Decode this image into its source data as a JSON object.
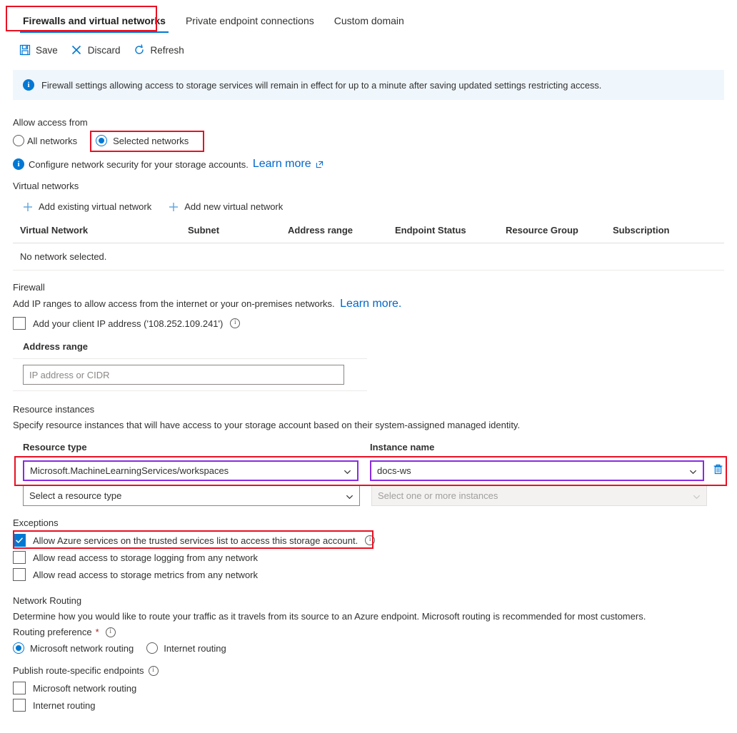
{
  "tabs": [
    {
      "label": "Firewalls and virtual networks",
      "active": true,
      "highlighted": true
    },
    {
      "label": "Private endpoint connections",
      "active": false,
      "highlighted": false
    },
    {
      "label": "Custom domain",
      "active": false,
      "highlighted": false
    }
  ],
  "toolbar": {
    "save_label": "Save",
    "discard_label": "Discard",
    "refresh_label": "Refresh",
    "save_icon": "save-floppy-icon",
    "discard_icon": "close-x-icon",
    "refresh_icon": "refresh-circular-arrow-icon"
  },
  "banner": {
    "icon": "info-filled-icon",
    "text": "Firewall settings allowing access to storage services will remain in effect for up to a minute after saving updated settings restricting access.",
    "background": "#eff6fc"
  },
  "allow_access": {
    "section_label": "Allow access from",
    "options": [
      {
        "label": "All networks",
        "selected": false
      },
      {
        "label": "Selected networks",
        "selected": true
      }
    ],
    "hint_icon": "info-filled-icon",
    "hint_text": "Configure network security for your storage accounts.",
    "hint_link": "Learn more",
    "hint_link_icon": "external-link-icon"
  },
  "virtual_networks": {
    "section_label": "Virtual networks",
    "actions": [
      {
        "label": "Add existing virtual network",
        "icon": "plus-icon"
      },
      {
        "label": "Add new virtual network",
        "icon": "plus-icon"
      }
    ],
    "columns": [
      "Virtual Network",
      "Subnet",
      "Address range",
      "Endpoint Status",
      "Resource Group",
      "Subscription"
    ],
    "empty_text": "No network selected."
  },
  "firewall": {
    "section_label": "Firewall",
    "description": "Add IP ranges to allow access from the internet or your on-premises networks.",
    "description_link": "Learn more.",
    "client_ip_checkbox": {
      "label": "Add your client IP address ('108.252.109.241')",
      "checked": false,
      "info_icon": "info-outline-icon"
    },
    "address_range_label": "Address range",
    "address_range_placeholder": "IP address or CIDR",
    "address_range_value": ""
  },
  "resource_instances": {
    "section_label": "Resource instances",
    "description": "Specify resource instances that will have access to your storage account based on their system-assigned managed identity.",
    "columns": {
      "resource_type": "Resource type",
      "instance_name": "Instance name"
    },
    "rows": [
      {
        "resource_type_value": "Microsoft.MachineLearningServices/workspaces",
        "instance_name_value": "docs-ws",
        "focused": true,
        "highlighted": true,
        "disabled": false,
        "delete_icon": "trash-icon"
      },
      {
        "resource_type_value": "Select a resource type",
        "instance_name_value": "Select one or more instances",
        "focused": false,
        "highlighted": false,
        "disabled": true,
        "delete_icon": ""
      }
    ]
  },
  "exceptions": {
    "section_label": "Exceptions",
    "items": [
      {
        "label": "Allow Azure services on the trusted services list to access this storage account.",
        "checked": true,
        "info_icon": "info-outline-icon",
        "highlighted": true
      },
      {
        "label": "Allow read access to storage logging from any network",
        "checked": false,
        "info_icon": "",
        "highlighted": false
      },
      {
        "label": "Allow read access to storage metrics from any network",
        "checked": false,
        "info_icon": "",
        "highlighted": false
      }
    ]
  },
  "network_routing": {
    "section_label": "Network Routing",
    "description": "Determine how you would like to route your traffic as it travels from its source to an Azure endpoint. Microsoft routing is recommended for most customers.",
    "routing_preference_label": "Routing preference",
    "required_marker": "*",
    "routing_preference_info_icon": "info-outline-icon",
    "routing_options": [
      {
        "label": "Microsoft network routing",
        "selected": true
      },
      {
        "label": "Internet routing",
        "selected": false
      }
    ],
    "publish_label": "Publish route-specific endpoints",
    "publish_info_icon": "info-outline-icon",
    "publish_options": [
      {
        "label": "Microsoft network routing",
        "checked": false
      },
      {
        "label": "Internet routing",
        "checked": false
      }
    ]
  },
  "colors": {
    "accent_blue": "#0078d4",
    "link_blue": "#0066cc",
    "highlight_red": "#e81123",
    "focus_purple": "#8a2be2",
    "banner_blue": "#eff6fc",
    "required_red": "#a4262c"
  }
}
